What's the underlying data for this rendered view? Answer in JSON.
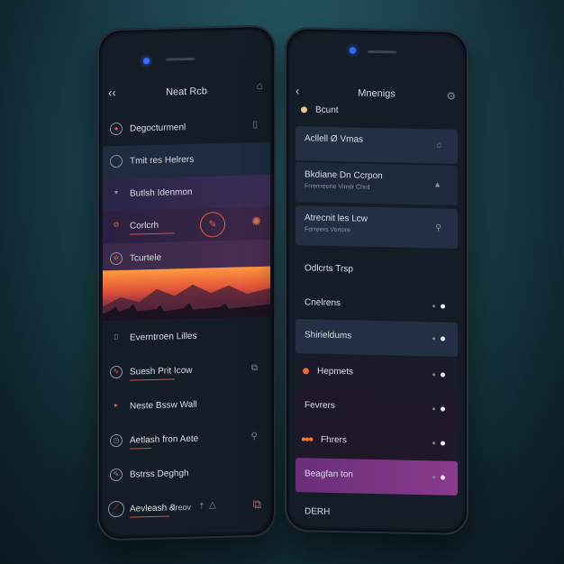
{
  "left": {
    "title": "Neat Rcb",
    "items": [
      {
        "label": "Degocturmenl"
      },
      {
        "label": "Tmit res Helrers"
      },
      {
        "label": "Butlsh Idenmon"
      },
      {
        "label": "Corlcrh"
      },
      {
        "label": "Tcurtele"
      },
      {
        "label": "Everntroen Lilles"
      },
      {
        "label": "Suesh Prit Icow"
      },
      {
        "label": "Neste Bssw Wall"
      },
      {
        "label": "Aetlash fron Aete"
      },
      {
        "label": "Bstrss Deghgh"
      },
      {
        "label": "Aevleash &",
        "extra": "Ireov"
      }
    ]
  },
  "right": {
    "title": "Mnenigs",
    "items": [
      {
        "label": "Bcunt"
      },
      {
        "label": "Acllell Ø Vmas"
      },
      {
        "label": "Bkdiane Dn Ccrpon",
        "sub": "Frrerrreone Vinstr Chrd"
      },
      {
        "label": "Atrecnit les Lcw",
        "sub": "Ferreers Vortore"
      },
      {
        "label": "Odlcrts Trsp"
      },
      {
        "label": "Cnelrens"
      },
      {
        "label": "Shirieldums"
      },
      {
        "label": "Hepmets"
      },
      {
        "label": "Fevrers"
      },
      {
        "label": "Fhrers"
      },
      {
        "label": "Beagfan ton"
      },
      {
        "label": "DERH"
      }
    ]
  },
  "colors": {
    "accent": "#e4553a",
    "selected": "#7a3585"
  }
}
